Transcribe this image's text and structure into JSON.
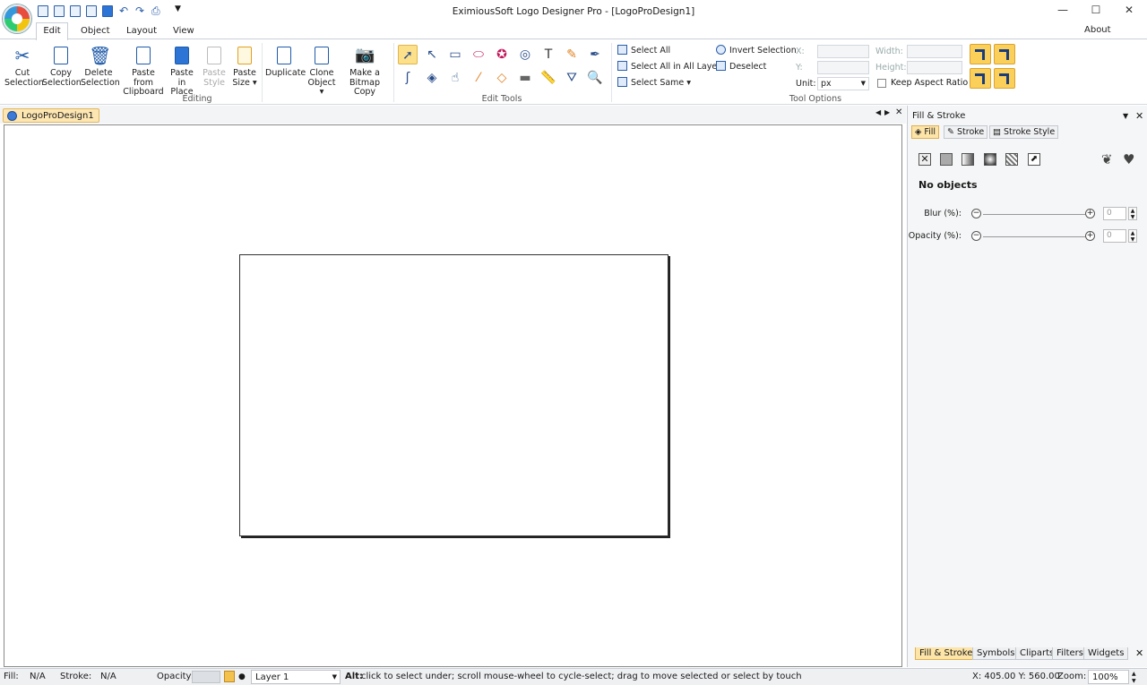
{
  "window": {
    "title": "EximiousSoft Logo Designer Pro - [LogoProDesign1]",
    "minimize": "—",
    "maximize": "☐",
    "close": "✕",
    "about": "About"
  },
  "tabs": [
    "Edit",
    "Object",
    "Layout",
    "View"
  ],
  "ribbon": {
    "editing": {
      "label": "Editing",
      "cut": [
        "Cut",
        "Selection"
      ],
      "copy": [
        "Copy",
        "Selection"
      ],
      "delete": [
        "Delete",
        "Selection"
      ],
      "paste_clip": [
        "Paste from",
        "Clipboard"
      ],
      "paste_place": [
        "Paste in",
        "Place"
      ],
      "paste_style": [
        "Paste",
        "Style"
      ],
      "paste_size": [
        "Paste",
        "Size ▾"
      ]
    },
    "duplicate": "Duplicate",
    "clone": [
      "Clone",
      "Object ▾"
    ],
    "bitmap": [
      "Make a",
      "Bitmap Copy"
    ],
    "edit_tools_label": "Edit Tools",
    "selection": {
      "select_all": "Select All",
      "select_all_layers": "Select All in All Layers",
      "select_same": "Select Same ▾",
      "invert": "Invert Selection",
      "deselect": "Deselect"
    },
    "tool_options": {
      "label": "Tool Options",
      "x": "X:",
      "y": "Y:",
      "width": "Width:",
      "height": "Height:",
      "unit_label": "Unit:",
      "unit_value": "px",
      "keep_aspect": "Keep Aspect Ratio"
    }
  },
  "document": {
    "tab": "LogoProDesign1"
  },
  "panel": {
    "title": "Fill & Stroke",
    "tabs": [
      "Fill",
      "Stroke",
      "Stroke Style"
    ],
    "no_objects": "No objects",
    "blur_label": "Blur (%):",
    "blur_value": "0",
    "opacity_label": "Opacity (%):",
    "opacity_value": "0",
    "bottom_tabs": [
      "Fill & Stroke",
      "Symbols",
      "Cliparts",
      "Filters",
      "Widgets"
    ]
  },
  "status": {
    "fill_label": "Fill:",
    "fill_value": "N/A",
    "stroke_label": "Stroke:",
    "stroke_value": "N/A",
    "opacity_label": "Opacity:",
    "layer": "Layer 1",
    "hint_bold": "Alt:",
    "hint": "click to select under; scroll mouse-wheel to cycle-select; drag to move selected or select by touch",
    "coords": "X: 405.00 Y: 560.00",
    "zoom_label": "Zoom:",
    "zoom_value": "100%"
  }
}
